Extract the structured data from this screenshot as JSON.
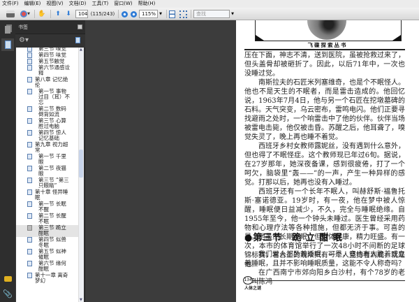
{
  "menu": [
    "文件(F)",
    "编辑(E)",
    "视图(V)",
    "文档(D)",
    "工具(T)",
    "窗口(W)",
    "帮助(H)"
  ],
  "toolbar": {
    "page_value": "104",
    "page_count": "(115/243)",
    "zoom_value": "115%",
    "search_placeholder": "查找"
  },
  "sidebar": {
    "panel_title": "书签",
    "bookmarks": [
      {
        "label": "第三节 嗅觉",
        "level": 2
      },
      {
        "label": "第四节 味觉",
        "level": 2
      },
      {
        "label": "第五节触觉",
        "level": 2
      },
      {
        "label": "第六节通感诠释",
        "level": 2
      },
      {
        "label": "第八章 记忆绝伦",
        "level": 1
      },
      {
        "label": "第一节 事物过目（耳）不忘",
        "level": 2
      },
      {
        "label": "第二节 数码倒背如流",
        "level": 2
      },
      {
        "label": "第三节 心算胜过电脑",
        "level": 2
      },
      {
        "label": "第四节 惊人记忆基础",
        "level": 2
      },
      {
        "label": "第九章 视力超常",
        "level": 1
      },
      {
        "label": "第一节 千里眼",
        "level": 2
      },
      {
        "label": "第二节 夜猫眼",
        "level": 2
      },
      {
        "label": "第三节 “第三只眼睛”",
        "level": 2
      },
      {
        "label": "第十章 怪异睡眠",
        "level": 1
      },
      {
        "label": "第一节 长眠不醒",
        "level": 2
      },
      {
        "label": "第二节 长醒不眠",
        "level": 2
      },
      {
        "label": "第三节 跪立酣眠",
        "level": 2,
        "selected": true
      },
      {
        "label": "第四节 似兽冬眠",
        "level": 2
      },
      {
        "label": "第五节 似神催眠",
        "level": 2
      },
      {
        "label": "第六节 缘何酣眠",
        "level": 2
      },
      {
        "label": "第十一章 离奇梦幻",
        "level": 1
      }
    ]
  },
  "document": {
    "series_title": "飞碟探索丛书",
    "paragraphs_top": [
      "压在下面，神志不清，送到医院，虽被抢救过来了，但头盖骨却被砸折了。因此，以后71年中，一次也没睡过觉。",
      "南斯拉夫的石匠米列塞维奇，也是个不眠怪人。他也不是天生的不眠者，而是雷击造成的。他回忆说，1963年7月4日，他与另一个石匠在挖墩墓碑的石料。天气突变，乌云密布，雷鸣电闪。他们正要寻找避雨之处时，一个响雷击中了他的伙伴。伙伴当场被雷电击毙，他仅被击昏。苏醒之后，他耳聋了，嗅觉失灵了，晚上再也睡不着觉。",
      "西班牙乡村女教师露妮丝，没有遇到什么意外，但也得了不眠怪症。这个教师现已年过6旬。据说，在27岁那年，她深夜备课，感到很疲倦，打了一个呵欠，脑袋里“轰——”的一声，产生一种异样的感觉。打那以后，她再也没有入睡过。",
      "西班牙还有一个长年不眠人，叫赫舒斯·福鲁托斯·塞诺德亚。19岁时，有一夜，他在梦中被人惊醒，睡眠便日益减少，不久，完全与睡眠绝缘。自1955年至今，他一个钟头未睡过。医生曾经采用药物和心理疗法等各种措施，但都无济于事。可喜的是，他虽然长期不眠，但身体健康，精力旺盛。有一次，本市的体育馆举行了一次48小时不间断的足球锦标赛，看台上的观众只有一个人坚持看到底，就是他。"
    ],
    "section_heading": "●第三节　跪 立 酣 眠",
    "paragraphs_bottom": [
      "我们常人都卧着睡眠，可是，竟也有人跪着或立着睡眠，且并不影响睡眠质量，这能不令人称奇吗？",
      "在广西南宁市郊向阳乡白沙村，有个78岁的老人叫陈鸿"
    ],
    "page_number": "134",
    "footer_title": "人体之谜"
  }
}
